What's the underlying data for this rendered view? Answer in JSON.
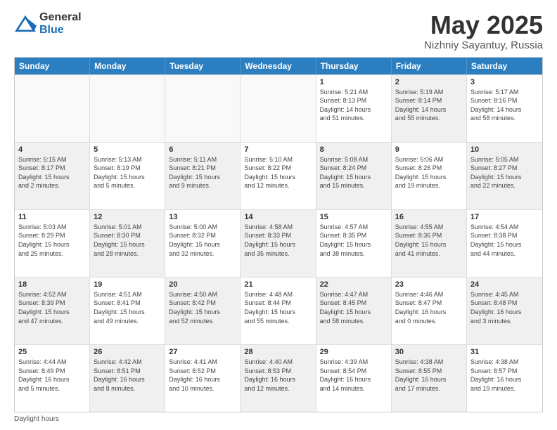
{
  "logo": {
    "general": "General",
    "blue": "Blue"
  },
  "title": {
    "month_year": "May 2025",
    "location": "Nizhniy Sayantuy, Russia"
  },
  "days_of_week": [
    "Sunday",
    "Monday",
    "Tuesday",
    "Wednesday",
    "Thursday",
    "Friday",
    "Saturday"
  ],
  "weeks": [
    [
      {
        "day": "",
        "info": "",
        "shaded": false,
        "empty": true
      },
      {
        "day": "",
        "info": "",
        "shaded": false,
        "empty": true
      },
      {
        "day": "",
        "info": "",
        "shaded": false,
        "empty": true
      },
      {
        "day": "",
        "info": "",
        "shaded": false,
        "empty": true
      },
      {
        "day": "1",
        "info": "Sunrise: 5:21 AM\nSunset: 8:13 PM\nDaylight: 14 hours\nand 51 minutes.",
        "shaded": false,
        "empty": false
      },
      {
        "day": "2",
        "info": "Sunrise: 5:19 AM\nSunset: 8:14 PM\nDaylight: 14 hours\nand 55 minutes.",
        "shaded": true,
        "empty": false
      },
      {
        "day": "3",
        "info": "Sunrise: 5:17 AM\nSunset: 8:16 PM\nDaylight: 14 hours\nand 58 minutes.",
        "shaded": false,
        "empty": false
      }
    ],
    [
      {
        "day": "4",
        "info": "Sunrise: 5:15 AM\nSunset: 8:17 PM\nDaylight: 15 hours\nand 2 minutes.",
        "shaded": true,
        "empty": false
      },
      {
        "day": "5",
        "info": "Sunrise: 5:13 AM\nSunset: 8:19 PM\nDaylight: 15 hours\nand 5 minutes.",
        "shaded": false,
        "empty": false
      },
      {
        "day": "6",
        "info": "Sunrise: 5:11 AM\nSunset: 8:21 PM\nDaylight: 15 hours\nand 9 minutes.",
        "shaded": true,
        "empty": false
      },
      {
        "day": "7",
        "info": "Sunrise: 5:10 AM\nSunset: 8:22 PM\nDaylight: 15 hours\nand 12 minutes.",
        "shaded": false,
        "empty": false
      },
      {
        "day": "8",
        "info": "Sunrise: 5:08 AM\nSunset: 8:24 PM\nDaylight: 15 hours\nand 15 minutes.",
        "shaded": true,
        "empty": false
      },
      {
        "day": "9",
        "info": "Sunrise: 5:06 AM\nSunset: 8:26 PM\nDaylight: 15 hours\nand 19 minutes.",
        "shaded": false,
        "empty": false
      },
      {
        "day": "10",
        "info": "Sunrise: 5:05 AM\nSunset: 8:27 PM\nDaylight: 15 hours\nand 22 minutes.",
        "shaded": true,
        "empty": false
      }
    ],
    [
      {
        "day": "11",
        "info": "Sunrise: 5:03 AM\nSunset: 8:29 PM\nDaylight: 15 hours\nand 25 minutes.",
        "shaded": false,
        "empty": false
      },
      {
        "day": "12",
        "info": "Sunrise: 5:01 AM\nSunset: 8:30 PM\nDaylight: 15 hours\nand 28 minutes.",
        "shaded": true,
        "empty": false
      },
      {
        "day": "13",
        "info": "Sunrise: 5:00 AM\nSunset: 8:32 PM\nDaylight: 15 hours\nand 32 minutes.",
        "shaded": false,
        "empty": false
      },
      {
        "day": "14",
        "info": "Sunrise: 4:58 AM\nSunset: 8:33 PM\nDaylight: 15 hours\nand 35 minutes.",
        "shaded": true,
        "empty": false
      },
      {
        "day": "15",
        "info": "Sunrise: 4:57 AM\nSunset: 8:35 PM\nDaylight: 15 hours\nand 38 minutes.",
        "shaded": false,
        "empty": false
      },
      {
        "day": "16",
        "info": "Sunrise: 4:55 AM\nSunset: 8:36 PM\nDaylight: 15 hours\nand 41 minutes.",
        "shaded": true,
        "empty": false
      },
      {
        "day": "17",
        "info": "Sunrise: 4:54 AM\nSunset: 8:38 PM\nDaylight: 15 hours\nand 44 minutes.",
        "shaded": false,
        "empty": false
      }
    ],
    [
      {
        "day": "18",
        "info": "Sunrise: 4:52 AM\nSunset: 8:39 PM\nDaylight: 15 hours\nand 47 minutes.",
        "shaded": true,
        "empty": false
      },
      {
        "day": "19",
        "info": "Sunrise: 4:51 AM\nSunset: 8:41 PM\nDaylight: 15 hours\nand 49 minutes.",
        "shaded": false,
        "empty": false
      },
      {
        "day": "20",
        "info": "Sunrise: 4:50 AM\nSunset: 8:42 PM\nDaylight: 15 hours\nand 52 minutes.",
        "shaded": true,
        "empty": false
      },
      {
        "day": "21",
        "info": "Sunrise: 4:48 AM\nSunset: 8:44 PM\nDaylight: 15 hours\nand 55 minutes.",
        "shaded": false,
        "empty": false
      },
      {
        "day": "22",
        "info": "Sunrise: 4:47 AM\nSunset: 8:45 PM\nDaylight: 15 hours\nand 58 minutes.",
        "shaded": true,
        "empty": false
      },
      {
        "day": "23",
        "info": "Sunrise: 4:46 AM\nSunset: 8:47 PM\nDaylight: 16 hours\nand 0 minutes.",
        "shaded": false,
        "empty": false
      },
      {
        "day": "24",
        "info": "Sunrise: 4:45 AM\nSunset: 8:48 PM\nDaylight: 16 hours\nand 3 minutes.",
        "shaded": true,
        "empty": false
      }
    ],
    [
      {
        "day": "25",
        "info": "Sunrise: 4:44 AM\nSunset: 8:49 PM\nDaylight: 16 hours\nand 5 minutes.",
        "shaded": false,
        "empty": false
      },
      {
        "day": "26",
        "info": "Sunrise: 4:42 AM\nSunset: 8:51 PM\nDaylight: 16 hours\nand 8 minutes.",
        "shaded": true,
        "empty": false
      },
      {
        "day": "27",
        "info": "Sunrise: 4:41 AM\nSunset: 8:52 PM\nDaylight: 16 hours\nand 10 minutes.",
        "shaded": false,
        "empty": false
      },
      {
        "day": "28",
        "info": "Sunrise: 4:40 AM\nSunset: 8:53 PM\nDaylight: 16 hours\nand 12 minutes.",
        "shaded": true,
        "empty": false
      },
      {
        "day": "29",
        "info": "Sunrise: 4:39 AM\nSunset: 8:54 PM\nDaylight: 16 hours\nand 14 minutes.",
        "shaded": false,
        "empty": false
      },
      {
        "day": "30",
        "info": "Sunrise: 4:38 AM\nSunset: 8:55 PM\nDaylight: 16 hours\nand 17 minutes.",
        "shaded": true,
        "empty": false
      },
      {
        "day": "31",
        "info": "Sunrise: 4:38 AM\nSunset: 8:57 PM\nDaylight: 16 hours\nand 19 minutes.",
        "shaded": false,
        "empty": false
      }
    ]
  ],
  "footer": {
    "note": "Daylight hours"
  }
}
